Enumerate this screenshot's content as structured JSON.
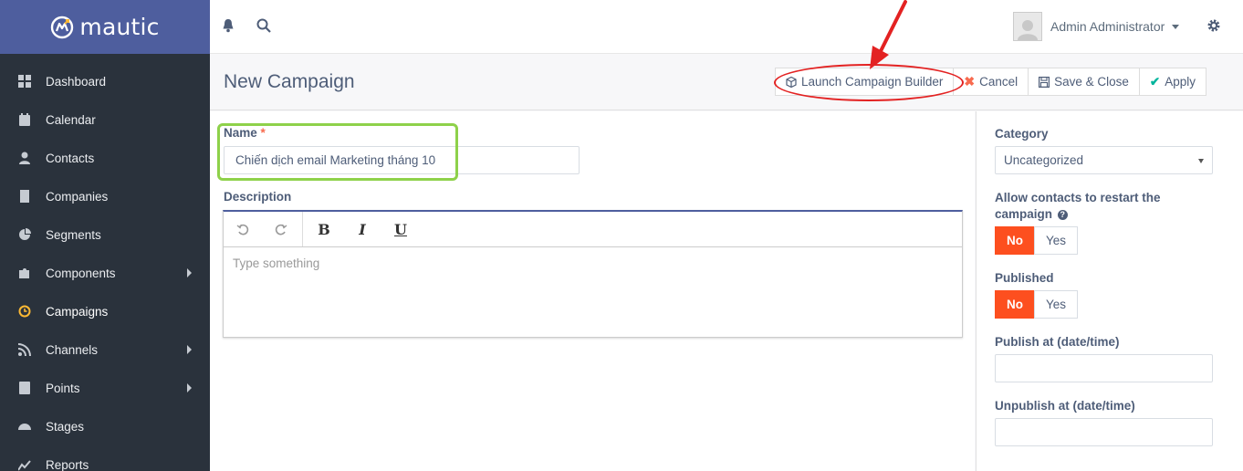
{
  "brand": {
    "name": "mautic"
  },
  "sidebar": {
    "items": [
      {
        "label": "Dashboard",
        "icon": "grid-icon",
        "has_submenu": false
      },
      {
        "label": "Calendar",
        "icon": "calendar-icon",
        "has_submenu": false
      },
      {
        "label": "Contacts",
        "icon": "user-icon",
        "has_submenu": false
      },
      {
        "label": "Companies",
        "icon": "building-icon",
        "has_submenu": false
      },
      {
        "label": "Segments",
        "icon": "pie-chart-icon",
        "has_submenu": false
      },
      {
        "label": "Components",
        "icon": "puzzle-icon",
        "has_submenu": true
      },
      {
        "label": "Campaigns",
        "icon": "clock-icon",
        "has_submenu": false,
        "active": true
      },
      {
        "label": "Channels",
        "icon": "rss-icon",
        "has_submenu": true
      },
      {
        "label": "Points",
        "icon": "calculator-icon",
        "has_submenu": true
      },
      {
        "label": "Stages",
        "icon": "tachometer-icon",
        "has_submenu": false
      },
      {
        "label": "Reports",
        "icon": "line-chart-icon",
        "has_submenu": false
      }
    ]
  },
  "topbar": {
    "user_name": "Admin Administrator"
  },
  "header": {
    "title": "New Campaign",
    "buttons": {
      "launch": "Launch Campaign Builder",
      "cancel": "Cancel",
      "save_close": "Save & Close",
      "apply": "Apply"
    }
  },
  "form": {
    "name_label": "Name",
    "required_mark": "*",
    "name_value": "Chiến dịch email Marketing tháng 10",
    "description_label": "Description",
    "editor": {
      "bold": "B",
      "italic": "I",
      "underline": "U",
      "placeholder": "Type something"
    }
  },
  "right_panel": {
    "category_label": "Category",
    "category_value": "Uncategorized",
    "restart_label": "Allow contacts to restart the campaign",
    "restart_help": "?",
    "restart_no": "No",
    "restart_yes": "Yes",
    "published_label": "Published",
    "published_no": "No",
    "published_yes": "Yes",
    "publish_at_label": "Publish at (date/time)",
    "publish_at_value": "",
    "unpublish_at_label": "Unpublish at (date/time)",
    "unpublish_at_value": ""
  },
  "colors": {
    "sidebar_bg": "#2a323c",
    "brand_bg": "#4e5e9e",
    "active_icon": "#fdb933",
    "toggle_on": "#fd4f1f",
    "annotation_red": "#e32222",
    "annotation_green": "#8ed14a"
  }
}
